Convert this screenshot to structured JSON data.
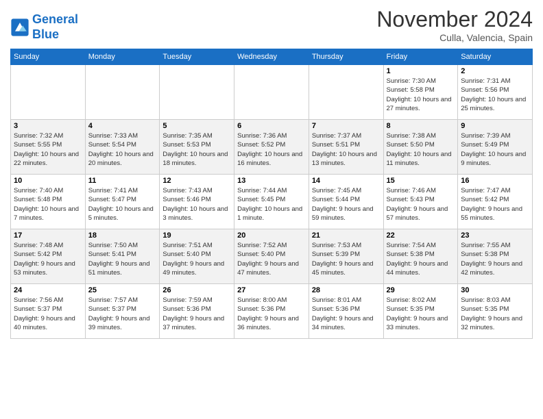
{
  "header": {
    "logo_line1": "General",
    "logo_line2": "Blue",
    "month": "November 2024",
    "location": "Culla, Valencia, Spain"
  },
  "weekdays": [
    "Sunday",
    "Monday",
    "Tuesday",
    "Wednesday",
    "Thursday",
    "Friday",
    "Saturday"
  ],
  "weeks": [
    [
      {
        "day": "",
        "info": ""
      },
      {
        "day": "",
        "info": ""
      },
      {
        "day": "",
        "info": ""
      },
      {
        "day": "",
        "info": ""
      },
      {
        "day": "",
        "info": ""
      },
      {
        "day": "1",
        "info": "Sunrise: 7:30 AM\nSunset: 5:58 PM\nDaylight: 10 hours and 27 minutes."
      },
      {
        "day": "2",
        "info": "Sunrise: 7:31 AM\nSunset: 5:56 PM\nDaylight: 10 hours and 25 minutes."
      }
    ],
    [
      {
        "day": "3",
        "info": "Sunrise: 7:32 AM\nSunset: 5:55 PM\nDaylight: 10 hours and 22 minutes."
      },
      {
        "day": "4",
        "info": "Sunrise: 7:33 AM\nSunset: 5:54 PM\nDaylight: 10 hours and 20 minutes."
      },
      {
        "day": "5",
        "info": "Sunrise: 7:35 AM\nSunset: 5:53 PM\nDaylight: 10 hours and 18 minutes."
      },
      {
        "day": "6",
        "info": "Sunrise: 7:36 AM\nSunset: 5:52 PM\nDaylight: 10 hours and 16 minutes."
      },
      {
        "day": "7",
        "info": "Sunrise: 7:37 AM\nSunset: 5:51 PM\nDaylight: 10 hours and 13 minutes."
      },
      {
        "day": "8",
        "info": "Sunrise: 7:38 AM\nSunset: 5:50 PM\nDaylight: 10 hours and 11 minutes."
      },
      {
        "day": "9",
        "info": "Sunrise: 7:39 AM\nSunset: 5:49 PM\nDaylight: 10 hours and 9 minutes."
      }
    ],
    [
      {
        "day": "10",
        "info": "Sunrise: 7:40 AM\nSunset: 5:48 PM\nDaylight: 10 hours and 7 minutes."
      },
      {
        "day": "11",
        "info": "Sunrise: 7:41 AM\nSunset: 5:47 PM\nDaylight: 10 hours and 5 minutes."
      },
      {
        "day": "12",
        "info": "Sunrise: 7:43 AM\nSunset: 5:46 PM\nDaylight: 10 hours and 3 minutes."
      },
      {
        "day": "13",
        "info": "Sunrise: 7:44 AM\nSunset: 5:45 PM\nDaylight: 10 hours and 1 minute."
      },
      {
        "day": "14",
        "info": "Sunrise: 7:45 AM\nSunset: 5:44 PM\nDaylight: 9 hours and 59 minutes."
      },
      {
        "day": "15",
        "info": "Sunrise: 7:46 AM\nSunset: 5:43 PM\nDaylight: 9 hours and 57 minutes."
      },
      {
        "day": "16",
        "info": "Sunrise: 7:47 AM\nSunset: 5:42 PM\nDaylight: 9 hours and 55 minutes."
      }
    ],
    [
      {
        "day": "17",
        "info": "Sunrise: 7:48 AM\nSunset: 5:42 PM\nDaylight: 9 hours and 53 minutes."
      },
      {
        "day": "18",
        "info": "Sunrise: 7:50 AM\nSunset: 5:41 PM\nDaylight: 9 hours and 51 minutes."
      },
      {
        "day": "19",
        "info": "Sunrise: 7:51 AM\nSunset: 5:40 PM\nDaylight: 9 hours and 49 minutes."
      },
      {
        "day": "20",
        "info": "Sunrise: 7:52 AM\nSunset: 5:40 PM\nDaylight: 9 hours and 47 minutes."
      },
      {
        "day": "21",
        "info": "Sunrise: 7:53 AM\nSunset: 5:39 PM\nDaylight: 9 hours and 45 minutes."
      },
      {
        "day": "22",
        "info": "Sunrise: 7:54 AM\nSunset: 5:38 PM\nDaylight: 9 hours and 44 minutes."
      },
      {
        "day": "23",
        "info": "Sunrise: 7:55 AM\nSunset: 5:38 PM\nDaylight: 9 hours and 42 minutes."
      }
    ],
    [
      {
        "day": "24",
        "info": "Sunrise: 7:56 AM\nSunset: 5:37 PM\nDaylight: 9 hours and 40 minutes."
      },
      {
        "day": "25",
        "info": "Sunrise: 7:57 AM\nSunset: 5:37 PM\nDaylight: 9 hours and 39 minutes."
      },
      {
        "day": "26",
        "info": "Sunrise: 7:59 AM\nSunset: 5:36 PM\nDaylight: 9 hours and 37 minutes."
      },
      {
        "day": "27",
        "info": "Sunrise: 8:00 AM\nSunset: 5:36 PM\nDaylight: 9 hours and 36 minutes."
      },
      {
        "day": "28",
        "info": "Sunrise: 8:01 AM\nSunset: 5:36 PM\nDaylight: 9 hours and 34 minutes."
      },
      {
        "day": "29",
        "info": "Sunrise: 8:02 AM\nSunset: 5:35 PM\nDaylight: 9 hours and 33 minutes."
      },
      {
        "day": "30",
        "info": "Sunrise: 8:03 AM\nSunset: 5:35 PM\nDaylight: 9 hours and 32 minutes."
      }
    ]
  ]
}
